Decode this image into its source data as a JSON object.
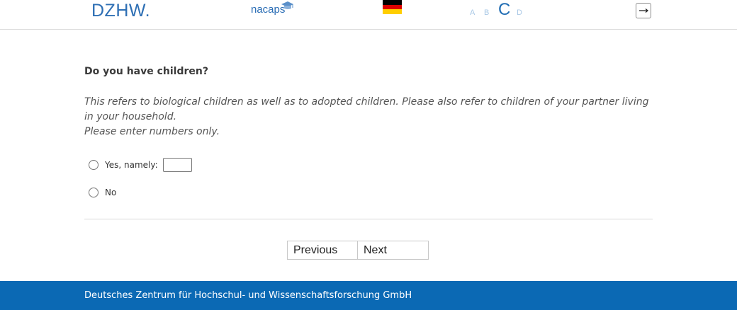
{
  "header": {
    "logo_dzhw": "DZHW.",
    "logo_nacaps": "nacaps",
    "flag_icon": "german-flag-icon",
    "font_sizes": [
      "A",
      "B",
      "C",
      "D"
    ],
    "logout_icon": "logout-arrow-icon",
    "flag_colors": [
      "#000000",
      "#dd0000",
      "#ffce00"
    ]
  },
  "question": {
    "title": "Do you have children?",
    "help_lines": [
      "This refers to biological children as well as to adopted children. Please also refer to children of your partner living in your household.",
      "Please enter numbers only."
    ],
    "options": [
      {
        "label": "Yes, namely:",
        "selected": false,
        "input_value": ""
      },
      {
        "label": "No",
        "selected": false
      }
    ]
  },
  "nav": {
    "previous_label": "Previous",
    "next_label": "Next"
  },
  "footer": {
    "text": "Deutsches Zentrum für Hochschul- und Wissenschaftsforschung GmbH"
  },
  "colors": {
    "brand_blue": "#0b69b4",
    "accent_blue": "#1f6cb3"
  }
}
